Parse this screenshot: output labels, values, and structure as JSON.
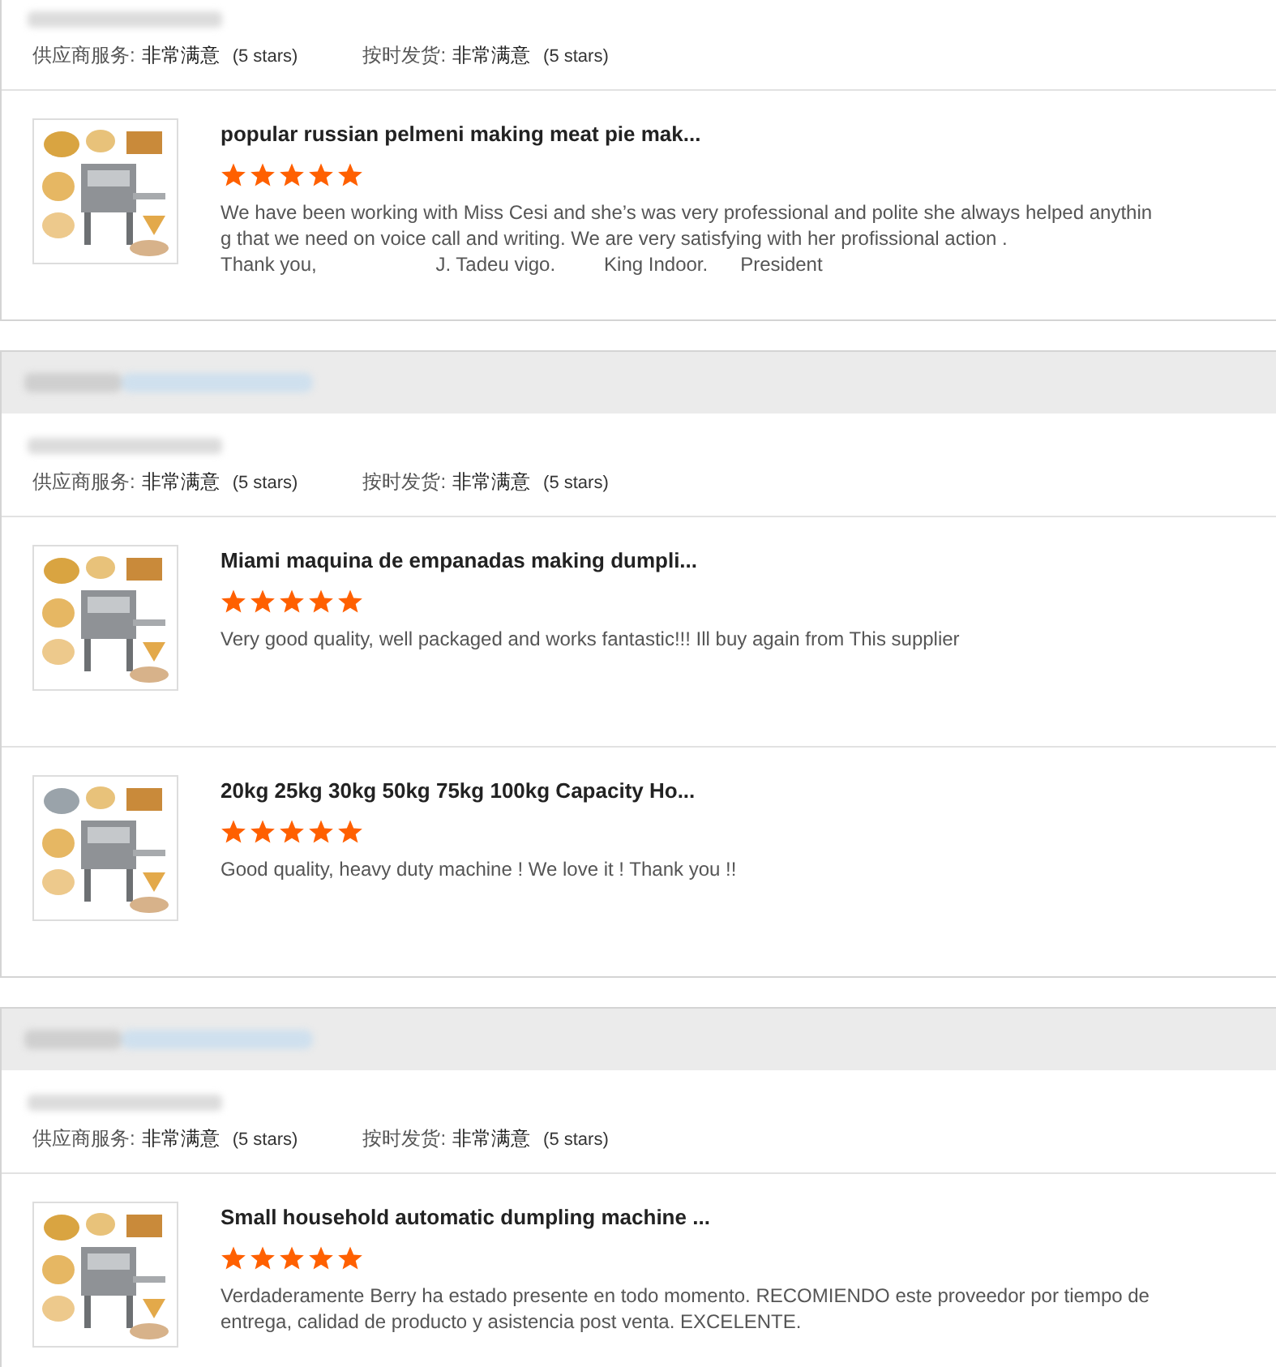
{
  "reviews": [
    {
      "header": false,
      "ratings": [
        {
          "label": "供应商服务:",
          "value": "非常满意",
          "note": "(5 stars)"
        },
        {
          "label": "按时发货:",
          "value": "非常满意",
          "note": "(5 stars)"
        }
      ],
      "products": [
        {
          "title": "popular russian pelmeni making meat pie mak...",
          "stars": 5,
          "text": "We have been working with Miss Cesi and she’s was very professional and polite she always helped anythin\ng that we need on voice call and writing. We are very satisfying with her profissional action .\nThank you,                      J. Tadeu vigo.         King Indoor.      President"
        }
      ]
    },
    {
      "header": true,
      "ratings": [
        {
          "label": "供应商服务:",
          "value": "非常满意",
          "note": "(5 stars)"
        },
        {
          "label": "按时发货:",
          "value": "非常满意",
          "note": "(5 stars)"
        }
      ],
      "products": [
        {
          "title": "Miami maquina de empanadas making dumpli...",
          "stars": 5,
          "text": "Very good quality, well packaged and works fantastic!!! Ill buy again from This supplier"
        },
        {
          "title": "20kg 25kg 30kg 50kg 75kg 100kg Capacity Ho...",
          "stars": 5,
          "text": "Good quality, heavy duty machine ! We love it ! Thank you !!"
        }
      ]
    },
    {
      "header": true,
      "ratings": [
        {
          "label": "供应商服务:",
          "value": "非常满意",
          "note": "(5 stars)"
        },
        {
          "label": "按时发货:",
          "value": "非常满意",
          "note": "(5 stars)"
        }
      ],
      "products": [
        {
          "title": "Small household automatic dumpling machine ...",
          "stars": 5,
          "text": "Verdaderamente Berry ha estado presente en todo momento. RECOMIENDO este proveedor por tiempo de\nentrega, calidad de producto y asistencia post venta. EXCELENTE."
        }
      ]
    }
  ]
}
